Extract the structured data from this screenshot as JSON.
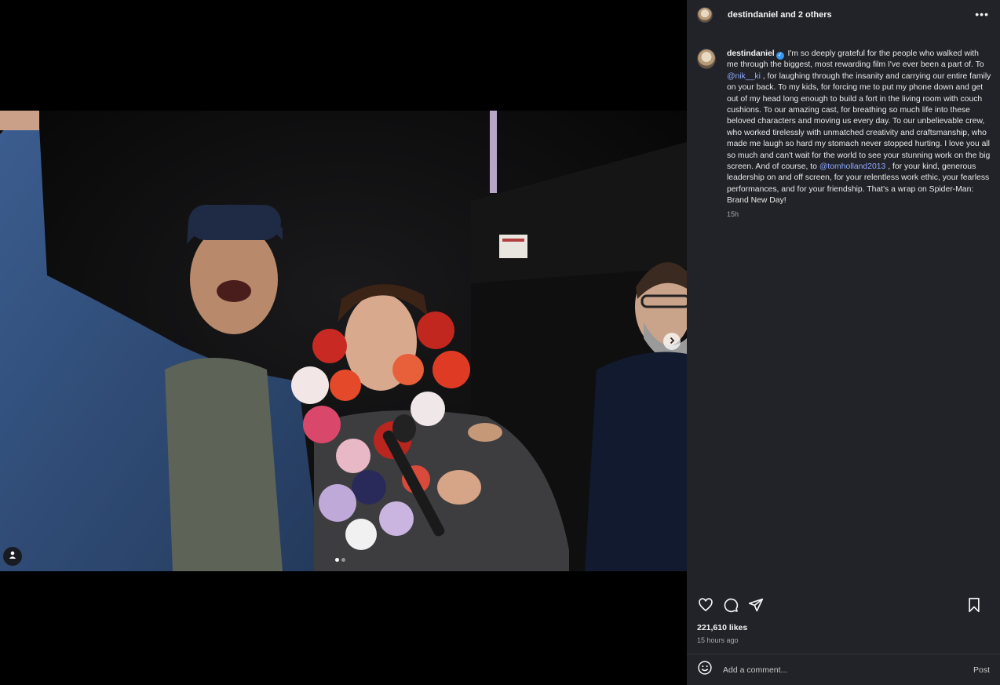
{
  "post": {
    "author": "destindaniel",
    "coauthors_suffix": "and 2 others",
    "more_icon": "ellipsis-icon",
    "caption_parts": [
      "I'm so deeply grateful for the people who walked with me through the biggest, most rewarding film I've ever been a part of. To ",
      "@nik__ki",
      ", for laughing through the insanity and carrying our entire family on your back. To my kids, for forcing me to put my phone down and get out of my head long enough to build a fort in the living room with couch cushions. To our amazing cast, for breathing so much life into these beloved characters and moving us every day. To our unbelievable crew, who worked tirelessly with unmatched creativity and craftsmanship, who made me laugh so hard my stomach never stopped hurting. I love you all so much and can't wait for the world to see your stunning work on the big screen. And of course, to ",
      "@tomholland2013",
      ", for your kind, generous leadership on and off screen, for your relentless work ethic, your fearless performances, and for your friendship. That's a wrap on Spider-Man: Brand New Day!"
    ],
    "caption_age": "15h",
    "likes": "221,610 likes",
    "posted_ago": "15 hours ago"
  },
  "media": {
    "carousel_index": 0,
    "carousel_count": 2,
    "icons": [
      "chevron-right-icon",
      "user-tag-icon"
    ]
  },
  "actions": {
    "icons": [
      "heart-icon",
      "comment-icon",
      "share-icon",
      "bookmark-icon"
    ]
  },
  "comment": {
    "placeholder": "Add a comment...",
    "post_label": "Post",
    "emoji_icon": "emoji-icon"
  },
  "colors": {
    "panel_bg": "#212328",
    "mention": "#8fa9ff",
    "verified": "#3897f0"
  }
}
